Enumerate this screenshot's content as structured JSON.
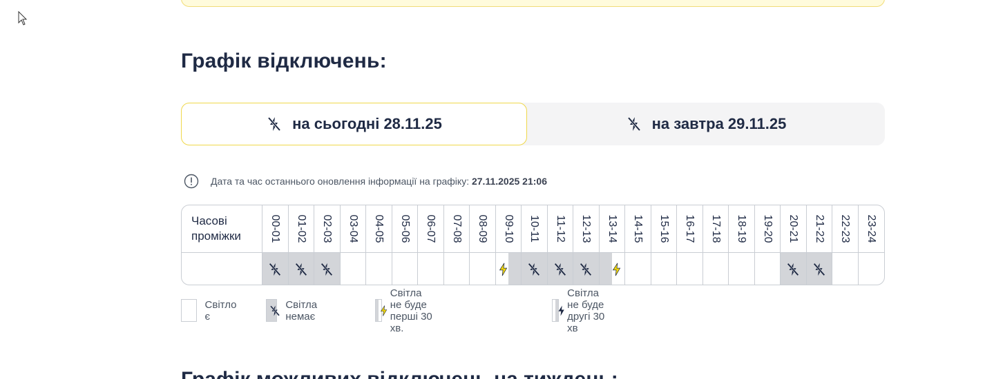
{
  "section": {
    "title": "Графік відключень:"
  },
  "tabs": [
    {
      "label": "на сьогодні 28.11.25",
      "active": true
    },
    {
      "label": "на завтра 29.11.25",
      "active": false
    }
  ],
  "update": {
    "label": "Дата та час останнього оновлення інформації на графіку:",
    "datetime": "27.11.2025 21:06"
  },
  "schedule": {
    "header_label_line1": "Часові",
    "header_label_line2": "проміжки",
    "hours": [
      "00-01",
      "01-02",
      "02-03",
      "03-04",
      "04-05",
      "05-06",
      "06-07",
      "07-08",
      "08-09",
      "09-10",
      "10-11",
      "11-12",
      "12-13",
      "13-14",
      "14-15",
      "15-16",
      "16-17",
      "17-18",
      "18-19",
      "19-20",
      "20-21",
      "21-22",
      "22-23",
      "23-24"
    ],
    "states": [
      "off",
      "off",
      "off",
      "on",
      "on",
      "on",
      "on",
      "on",
      "on",
      "first-half-on",
      "off",
      "off",
      "off",
      "second-half-on",
      "on",
      "on",
      "on",
      "on",
      "on",
      "on",
      "off",
      "off",
      "on",
      "on"
    ]
  },
  "legend": {
    "on": "Світло є",
    "off": "Світла немає",
    "first": "Світла не буде перші 30 хв.",
    "second": "Світла не буде другі 30 хв"
  },
  "next_section": {
    "title": "Графік можливих відключень на тиждень:"
  },
  "colors": {
    "accent_yellow": "#f5d90a",
    "off_gray": "#d3d5d9",
    "text_dark": "#1f2a44",
    "border": "#c9cdd3"
  },
  "icons": {
    "no_power": "lightning-crossed-icon",
    "info": "info-circle-icon",
    "cursor": "mouse-cursor-icon"
  }
}
